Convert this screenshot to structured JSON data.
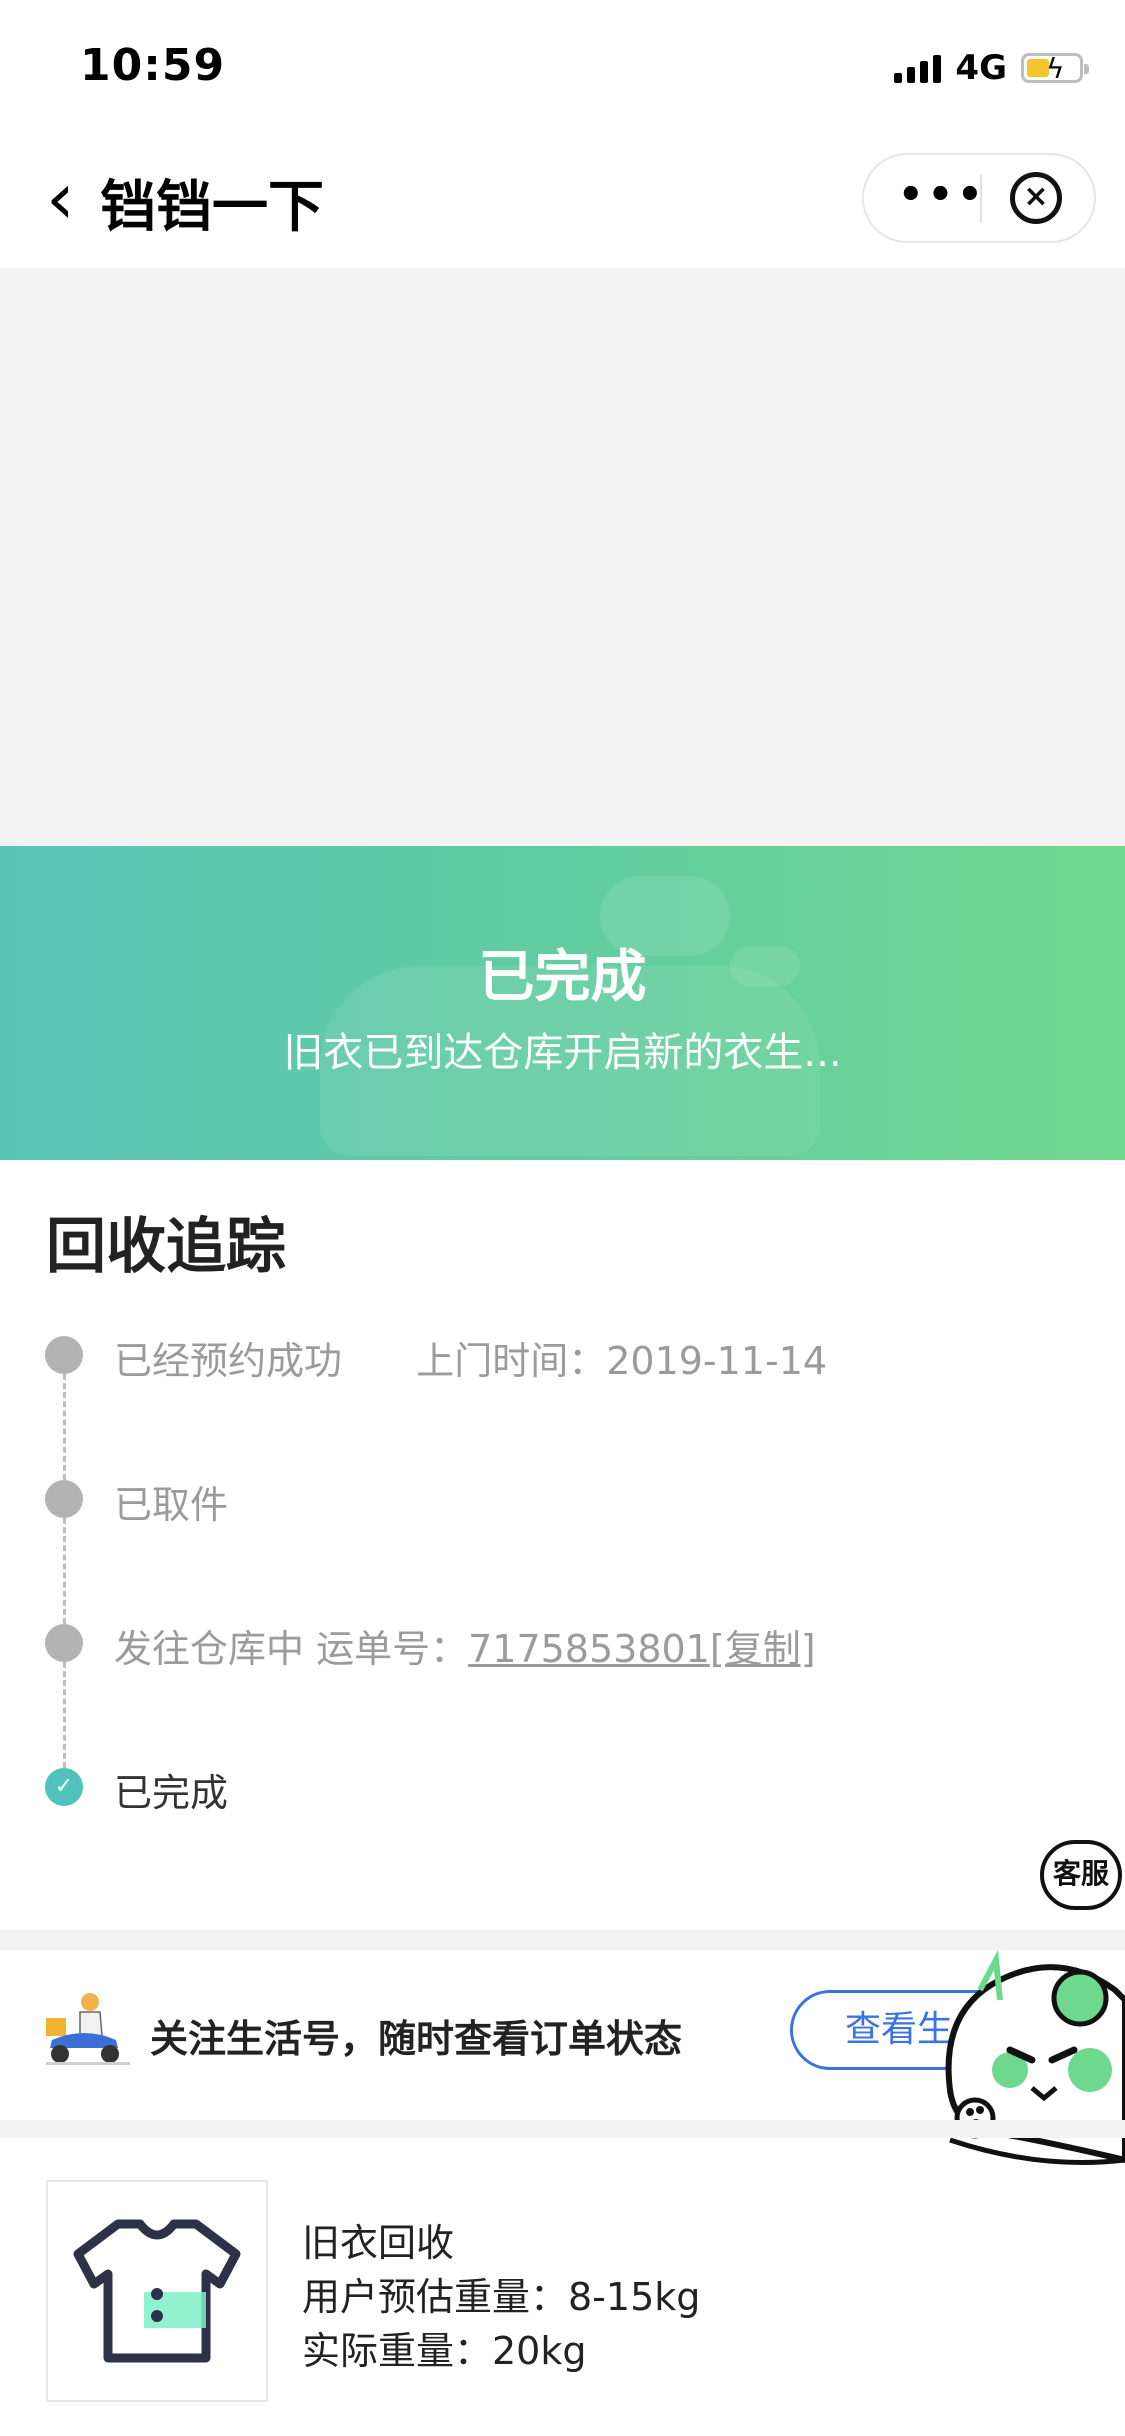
{
  "status_bar": {
    "time": "10:59",
    "network": "4G"
  },
  "nav": {
    "title": "铛铛一下"
  },
  "banner": {
    "title": "已完成",
    "subtitle": "旧衣已到达仓库开启新的衣生..."
  },
  "tracking": {
    "title": "回收追踪",
    "steps": [
      {
        "label": "已经预约成功",
        "extra_label": "上门时间：",
        "extra_value": "2019-11-14"
      },
      {
        "label": "已取件"
      },
      {
        "label": "发往仓库中 运单号：",
        "tracking_number": "7175853801",
        "copy_label": "[复制]"
      },
      {
        "label": "已完成"
      }
    ]
  },
  "follow": {
    "text": "关注生活号，随时查看订单状态",
    "button_label": "查看生"
  },
  "customer_service": {
    "label": "客服"
  },
  "order": {
    "name": "旧衣回收",
    "estimated_weight": "用户预估重量：8-15kg",
    "actual_weight": "实际重量：20kg"
  },
  "colors": {
    "banner_start": "#5ac3b7",
    "banner_end": "#6fd88f",
    "accent_blue": "#3b73e0",
    "check_teal": "#4fc2bd"
  }
}
